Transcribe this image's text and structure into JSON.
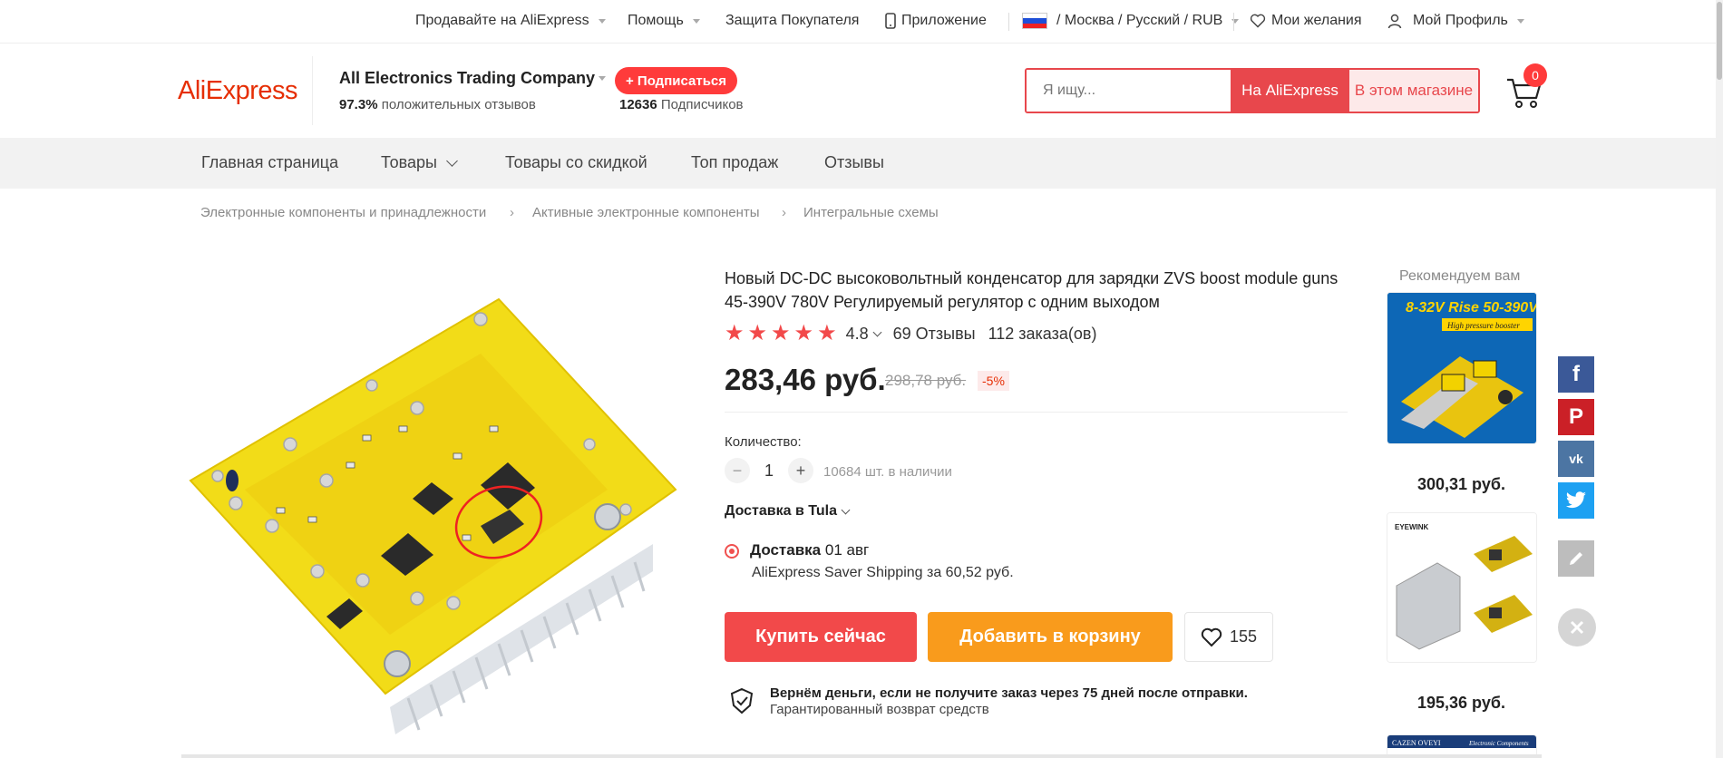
{
  "topbar": {
    "sell": "Продавайте на AliExpress",
    "help": "Помощь",
    "protection": "Защита Покупателя",
    "app": "Приложение",
    "locale": "/ Москва / Русский / RUB",
    "wishlist": "Мои желания",
    "profile": "Мой Профиль"
  },
  "header": {
    "logo": "AliExpress",
    "store_name": "All Electronics Trading Company",
    "positive_pct": "97.3%",
    "positive_label": "положительных отзывов",
    "subscribe": "+ Подписаться",
    "subscribers_count": "12636",
    "subscribers_label": "Подписчиков",
    "search_placeholder": "Я ищу...",
    "search_aliexpress": "На AliExpress",
    "search_store": "В этом магазине",
    "cart_count": "0"
  },
  "nav": {
    "home": "Главная страница",
    "products": "Товары",
    "discounts": "Товары со скидкой",
    "top_sales": "Топ продаж",
    "reviews": "Отзывы"
  },
  "breadcrumb": [
    "Электронные компоненты и принадлежности",
    "Активные электронные компоненты",
    "Интегральные схемы"
  ],
  "product": {
    "title": "Новый DC-DC высоковольтный конденсатор для зарядки ZVS boost module guns 45-390V 780V Регулируемый регулятор с одним выходом",
    "rating_value": "4.8",
    "stars_filled": 5,
    "reviews": "69 Отзывы",
    "orders": "112 заказа(ов)",
    "price": "283,46 руб.",
    "old_price": "298,78 руб.",
    "discount": "-5%",
    "quantity_label": "Количество:",
    "quantity_value": "1",
    "stock": "10684 шт. в наличии",
    "ship_to": "Доставка в Tula",
    "delivery_label": "Доставка",
    "delivery_date": "01 авг",
    "delivery_service": "AliExpress Saver Shipping за 60,52 руб.",
    "buy_now": "Купить сейчас",
    "add_to_cart": "Добавить в корзину",
    "wish_count": "155",
    "guarantee_main": "Вернём деньги, если не получите заказ через 75 дней после отправки.",
    "guarantee_sub": "Гарантированный возврат средств"
  },
  "recommend": {
    "title": "Рекомендуем вам",
    "items": [
      {
        "price": "300,31 руб.",
        "image_text_1": "8-32V Rise 50-390V",
        "image_text_2": "High pressure booster"
      },
      {
        "price": "195,36 руб.",
        "image_text_1": "EYEWINK"
      },
      {
        "image_text_1": "CAZEN OVEYI",
        "image_text_2": "Electronic Components"
      }
    ]
  },
  "colors": {
    "brand": "#e62e04",
    "accent_red": "#f2494a",
    "orange": "#f99b1c",
    "facebook": "#3b5998",
    "pinterest": "#cb2027",
    "vk": "#4c75a3",
    "twitter": "#1da1f2"
  },
  "icons": [
    "phone-icon",
    "flag-russia-icon",
    "heart-icon",
    "user-icon",
    "cart-icon",
    "chevron-down-icon",
    "chevron-right-icon",
    "star-icon",
    "shield-check-icon",
    "facebook-icon",
    "pinterest-icon",
    "vk-icon",
    "twitter-icon",
    "edit-icon",
    "close-icon"
  ]
}
